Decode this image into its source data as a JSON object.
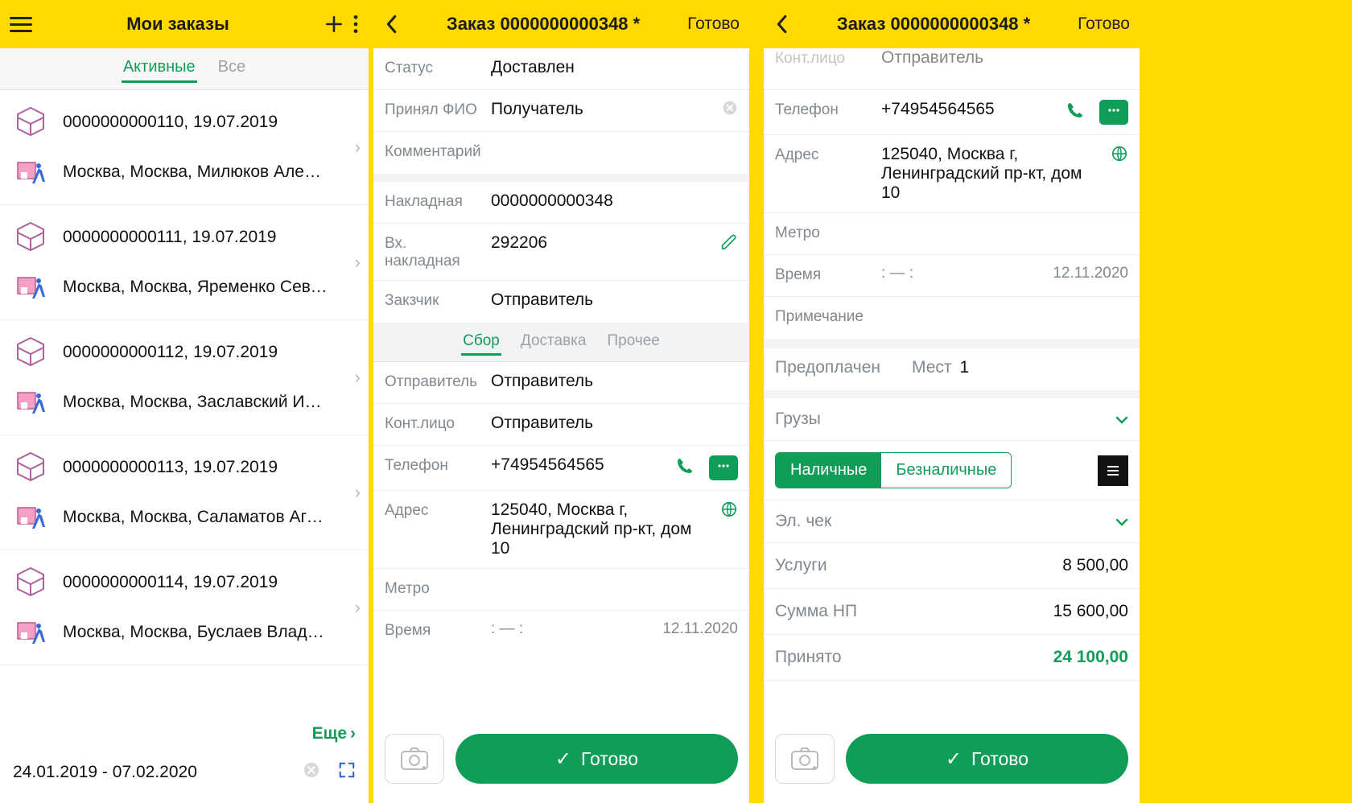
{
  "screen1": {
    "title": "Мои заказы",
    "tabs": {
      "active": "Активные",
      "all": "Все"
    },
    "orders": [
      {
        "num": "0000000000110, 19.07.2019",
        "addr": "Москва, Москва, Милюков Алексей"
      },
      {
        "num": "0000000000111, 19.07.2019",
        "addr": "Москва, Москва, Яременко Севасть..."
      },
      {
        "num": "0000000000112, 19.07.2019",
        "addr": "Москва, Москва, Заславский Измаил"
      },
      {
        "num": "0000000000113, 19.07.2019",
        "addr": "Москва, Москва, Саламатов Агафон"
      },
      {
        "num": "0000000000114, 19.07.2019",
        "addr": "Москва, Москва, Буслаев Владислав"
      }
    ],
    "more": "Еще",
    "dates": "24.01.2019 - 07.02.2020"
  },
  "screen2": {
    "title": "Заказ 0000000000348 *",
    "ready": "Готово",
    "fields": {
      "status_l": "Статус",
      "status_v": "Доставлен",
      "received_l": "Принял ФИО",
      "received_v": "Получатель",
      "comment_l": "Комментарий",
      "comment_v": "",
      "invoice_l": "Накладная",
      "invoice_v": "0000000000348",
      "in_invoice_l": "Вх. накладная",
      "in_invoice_v": "292206",
      "customer_l": "Закзчик",
      "customer_v": "Отправитель"
    },
    "subtabs": {
      "a": "Сбор",
      "b": "Доставка",
      "c": "Прочее"
    },
    "sender": {
      "sender_l": "Отправитель",
      "sender_v": "Отправитель",
      "contact_l": "Конт.лицо",
      "contact_v": "Отправитель",
      "phone_l": "Телефон",
      "phone_v": "+74954564565",
      "addr_l": "Адрес",
      "addr_v": "125040, Москва г, Ленинградский пр-кт, дом 10",
      "metro_l": "Метро",
      "metro_v": "",
      "time_l": "Время",
      "time_sep": ":   —   :",
      "time_d": "12.11.2020"
    },
    "done": "Готово"
  },
  "screen3": {
    "title": "Заказ 0000000000348 *",
    "ready": "Готово",
    "top": {
      "contact_l": "Конт.лицо",
      "contact_v": "Отправитель",
      "phone_l": "Телефон",
      "phone_v": "+74954564565",
      "addr_l": "Адрес",
      "addr_v": "125040, Москва г, Ленинградский пр-кт, дом 10",
      "metro_l": "Метро",
      "time_l": "Время",
      "time_sep": ":   —   :",
      "time_d": "12.11.2020",
      "note_l": "Примечание"
    },
    "prepaid_l": "Предоплачен",
    "places_l": "Мест",
    "places_v": "1",
    "cargo_l": "Грузы",
    "pay": {
      "cash": "Наличные",
      "noncash": "Безналичные"
    },
    "echeck_l": "Эл. чек",
    "amounts": {
      "services_l": "Услуги",
      "services_v": "8 500,00",
      "np_l": "Сумма НП",
      "np_v": "15 600,00",
      "accepted_l": "Принято",
      "accepted_v": "24 100,00"
    },
    "done": "Готово"
  }
}
